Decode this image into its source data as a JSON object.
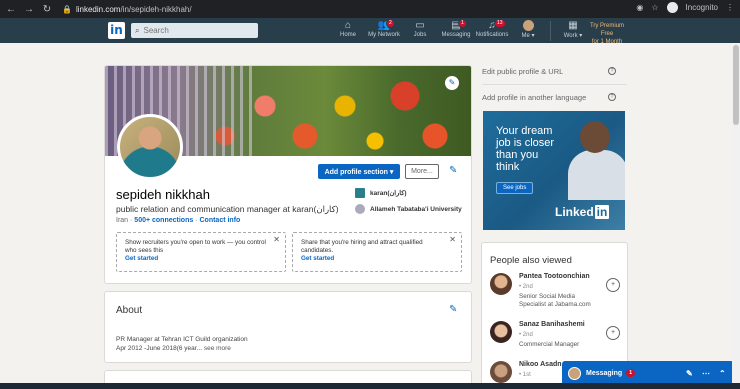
{
  "browser": {
    "url_domain": "linkedin.com",
    "url_path": "/in/sepideh-nikkhah/",
    "incognito_label": "Incognito"
  },
  "nav": {
    "logo": "in",
    "search_placeholder": "Search",
    "items": [
      {
        "label": "Home",
        "badge": ""
      },
      {
        "label": "My Network",
        "badge": "2"
      },
      {
        "label": "Jobs",
        "badge": ""
      },
      {
        "label": "Messaging",
        "badge": "1"
      },
      {
        "label": "Notifications",
        "badge": "13"
      },
      {
        "label": "Me ▾",
        "badge": ""
      },
      {
        "label": "Work ▾",
        "badge": ""
      }
    ],
    "premium_line1": "Try Premium Free",
    "premium_line2": "for 1 Month"
  },
  "profile": {
    "add_section_label": "Add profile section ▾",
    "more_label": "More...",
    "name": "sepideh nikkhah",
    "headline": "public relation and communication manager at karan(کاران)",
    "location": "Iran",
    "connections": "500+ connections",
    "contact": "Contact info",
    "company": "karan(کاران)",
    "school": "Allameh Tabataba'i University",
    "open_to_work": {
      "text": "Show recruiters you're open to work — you control who sees this",
      "link": "Get started"
    },
    "hiring": {
      "text": "Share that you're hiring and attract qualified candidates.",
      "link": "Get started"
    }
  },
  "about": {
    "title": "About",
    "line1": "PR Manager at Tehran ICT Guild organization",
    "line2": "Apr 2012 -June 2018(6 year...",
    "see_more": "see more"
  },
  "sidebar": {
    "edit_profile": "Edit public profile & URL",
    "add_language": "Add profile in another language",
    "ad": {
      "line1": "Your dream",
      "line2": "job is closer",
      "line3": "than you",
      "line4": "think",
      "button": "See jobs",
      "brand": "Linked",
      "brand_in": "in"
    },
    "people_title": "People also viewed",
    "people": [
      {
        "name": "Pantea Tootoonchian",
        "degree": "• 2nd",
        "job": "Senior Social Media Specialist at Jabama.com"
      },
      {
        "name": "Sanaz Banihashemi",
        "degree": "• 2nd",
        "job": "Commercial Manager"
      },
      {
        "name": "Nikoo Asadn...",
        "degree": "• 1st",
        "job": ""
      }
    ]
  },
  "messaging": {
    "label": "Messaging",
    "badge": "1"
  }
}
